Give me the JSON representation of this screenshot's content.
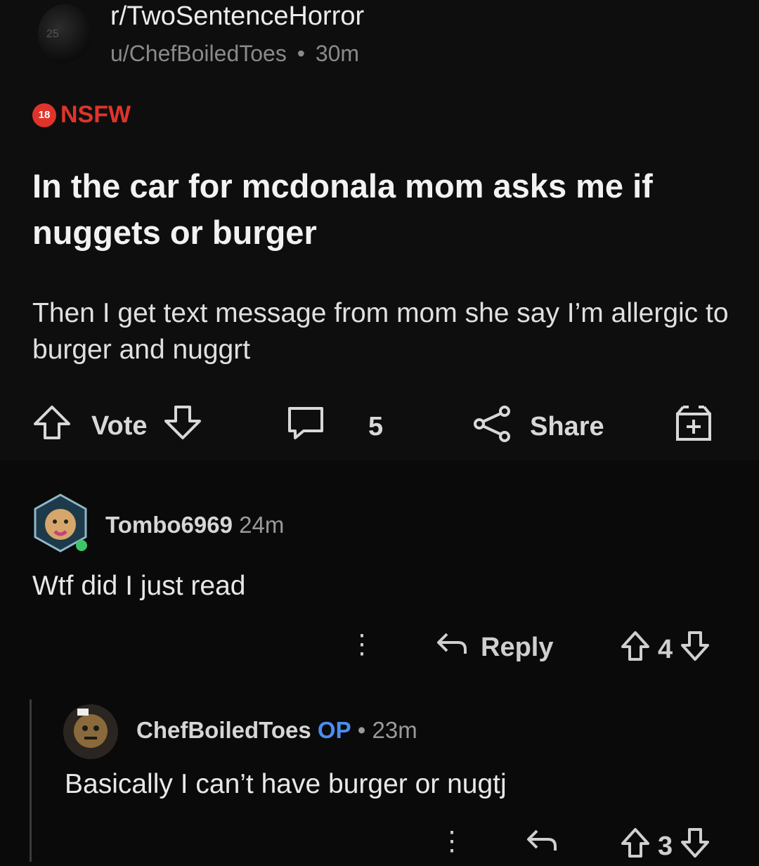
{
  "post": {
    "subreddit": "r/TwoSentenceHorror",
    "author": "u/ChefBoiledToes",
    "separator": "•",
    "age": "30m",
    "nsfw_badge": "18",
    "nsfw_label": "NSFW",
    "title": "In the car for mcdonala mom asks me if nuggets or burger",
    "body": "Then I get text message from mom she say I’m allergic to burger and nuggrt",
    "vote_label": "Vote",
    "comment_count": "5",
    "share_label": "Share",
    "icons": [
      "upvote-icon",
      "downvote-icon",
      "comment-icon",
      "share-icon",
      "award-icon"
    ]
  },
  "comments": [
    {
      "username": "Tombo6969",
      "age": "24m",
      "text": "Wtf did I just read",
      "reply_label": "Reply",
      "score": "4"
    },
    {
      "username": "ChefBoiledToes",
      "op_label": "OP",
      "separator": "•",
      "age": "23m",
      "text": "Basically I can’t have burger or nugtj",
      "score": "3"
    }
  ],
  "colors": {
    "background": "#0b0b0b",
    "nsfw": "#e0342b",
    "op": "#4a8df0",
    "text": "#e6e6e6",
    "muted": "#8a8a8a"
  }
}
